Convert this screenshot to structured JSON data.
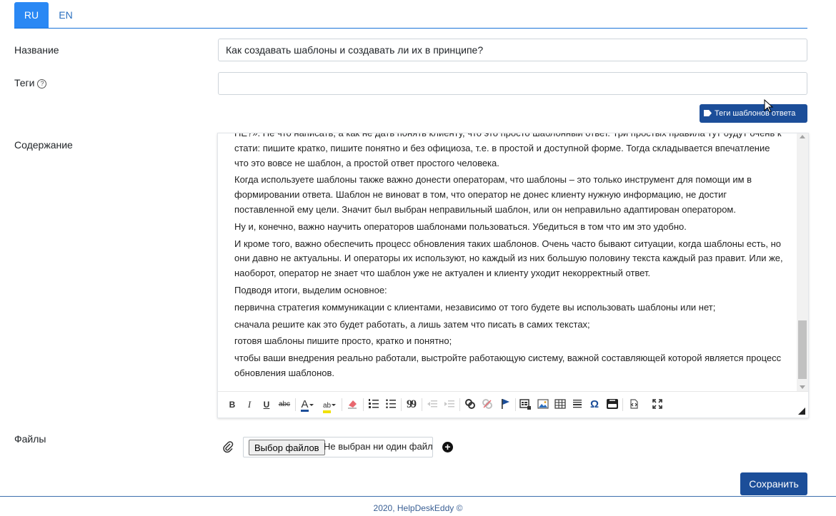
{
  "tabs": [
    {
      "label": "RU",
      "active": true
    },
    {
      "label": "EN",
      "active": false
    }
  ],
  "form": {
    "name_label": "Название",
    "name_value": "Как создавать шаблоны и создавать ли их в принципе?",
    "tags_label": "Теги",
    "tags_help_icon": "?",
    "tags_value": "",
    "tags_button_label": "Теги шаблонов ответа",
    "content_label": "Содержание",
    "files_label": "Файлы",
    "file_button_label": "Выбор файлов",
    "file_status": "Не выбран ни один файл",
    "save_label": "Сохранить"
  },
  "editor": {
    "paragraphs": [
      "НЕ?». Не что написать, а как не дать понять клиенту, что это просто шаблонный ответ. Три простых правила тут будут очень к стати: пишите кратко, пишите понятно и без официоза, т.е. в простой и доступной форме. Тогда складывается впечатление что это вовсе не шаблон, а простой ответ простого человека.",
      "Когда используете шаблоны также важно донести операторам, что шаблоны – это только инструмент для помощи им в формировании ответа. Шаблон не виноват в том, что оператор не донес клиенту нужную информацию, не достиг поставленной ему цели. Значит был выбран неправильный шаблон, или он неправильно адаптирован оператором.",
      "Ну и, конечно, важно научить операторов шаблонами пользоваться. Убедиться в том что им это удобно.",
      "И кроме того, важно обеспечить процесс обновления таких шаблонов. Очень часто бывают ситуации, когда шаблоны есть, но они давно не актуальны. И операторы их используют, но каждый из них большую половину текста каждый раз правит. Или же, наоборот, оператор не знает что шаблон уже не актуален и клиенту уходит некорректный ответ.",
      "Подводя итоги, выделим основное:",
      "первична стратегия коммуникации с клиентами, независимо от того будете вы использовать шаблоны или нет;",
      "сначала решите как это будет работать, а лишь затем что писать в самих текстах;",
      "готовя шаблоны пишите просто, кратко и понятно;",
      "чтобы ваши внедрения реально работали, выстройте работающую систему, важной составляющей которой является процесс обновления шаблонов."
    ],
    "toolbar": {
      "bold": "B",
      "italic": "I",
      "underline": "U",
      "strike": "abc",
      "text_color": "A",
      "highlight": "ab",
      "quote": "99",
      "special_char": "Ω"
    }
  },
  "footer": {
    "text": "2020, HelpDeskEddy ©"
  },
  "colors": {
    "tab_active": "#2a88f4",
    "primary_button": "#1c4e99",
    "footer_text": "#3a5f94"
  }
}
